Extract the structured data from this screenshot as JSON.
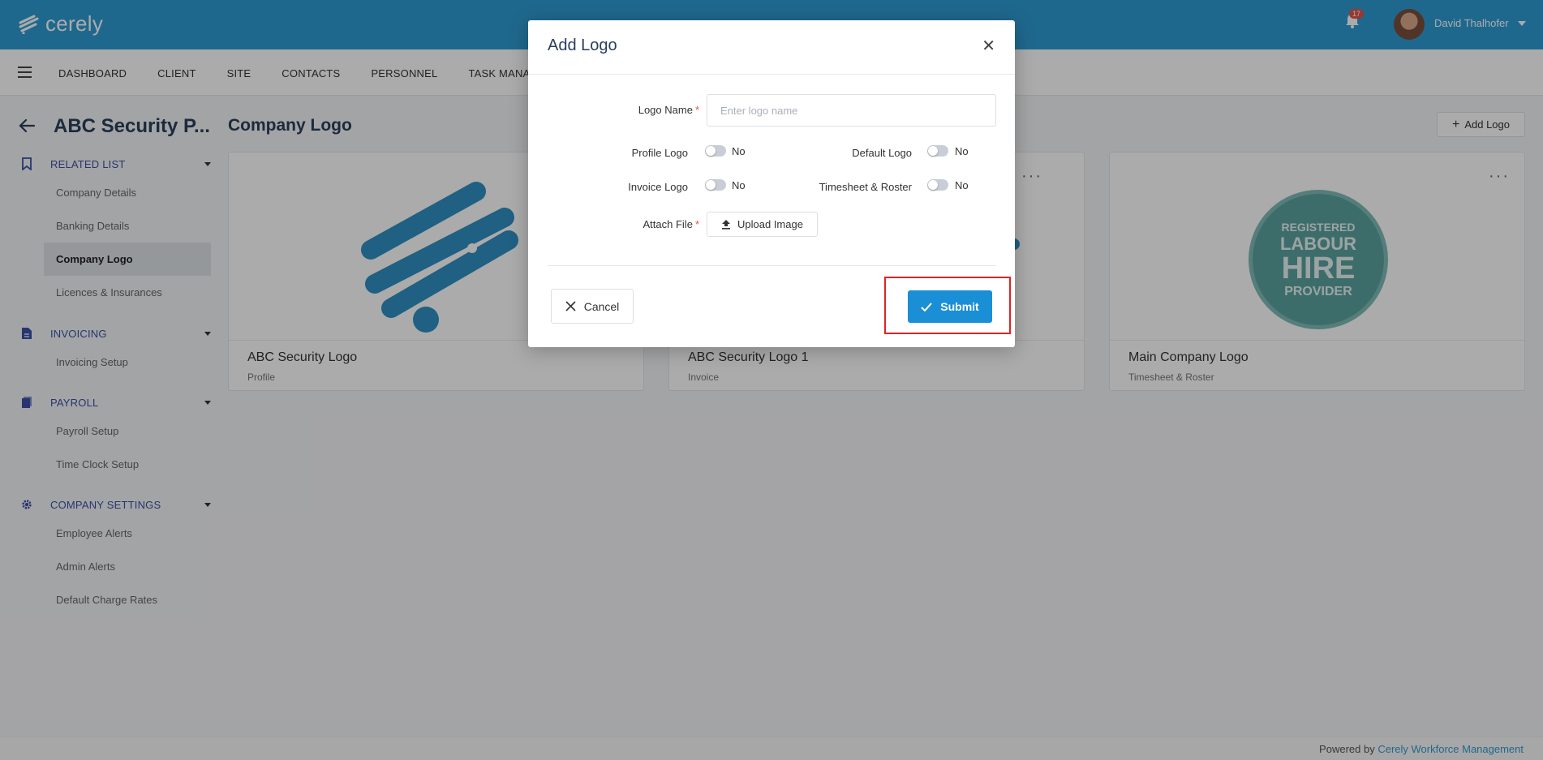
{
  "app": {
    "brand": "cerely",
    "notification_count": "17",
    "user_name": "David Thalhofer"
  },
  "nav": {
    "items": [
      "DASHBOARD",
      "CLIENT",
      "SITE",
      "CONTACTS",
      "PERSONNEL",
      "TASK MANAGER"
    ]
  },
  "sidebar": {
    "company_title": "ABC Security P...",
    "sections": [
      {
        "label": "RELATED LIST",
        "icon": "bookmark-icon",
        "items": [
          "Company Details",
          "Banking Details",
          "Company Logo",
          "Licences & Insurances"
        ]
      },
      {
        "label": "INVOICING",
        "icon": "document-icon",
        "items": [
          "Invoicing Setup"
        ]
      },
      {
        "label": "PAYROLL",
        "icon": "file-icon",
        "items": [
          "Payroll Setup",
          "Time Clock Setup"
        ]
      },
      {
        "label": "COMPANY SETTINGS",
        "icon": "gear-icon",
        "items": [
          "Employee Alerts",
          "Admin Alerts",
          "Default Charge Rates"
        ]
      }
    ],
    "active_item": "Company Logo"
  },
  "main": {
    "title": "Company Logo",
    "add_logo_label": "Add Logo",
    "cards": [
      {
        "name": "ABC Security Logo",
        "type": "Profile"
      },
      {
        "name": "ABC Security Logo 1",
        "type": "Invoice"
      },
      {
        "name": "Main Company Logo",
        "type": "Timesheet & Roster",
        "badge_lines": [
          "REGISTERED",
          "LABOUR",
          "HIRE",
          "PROVIDER"
        ]
      }
    ]
  },
  "modal": {
    "title": "Add Logo",
    "logo_name_label": "Logo Name",
    "logo_name_placeholder": "Enter logo name",
    "logo_name_value": "",
    "profile_logo_label": "Profile Logo",
    "profile_logo_value": "No",
    "default_logo_label": "Default Logo",
    "default_logo_value": "No",
    "invoice_logo_label": "Invoice Logo",
    "invoice_logo_value": "No",
    "timesheet_roster_label": "Timesheet & Roster",
    "timesheet_roster_value": "No",
    "attach_file_label": "Attach File",
    "upload_label": "Upload Image",
    "cancel_label": "Cancel",
    "submit_label": "Submit",
    "required_mark": "*"
  },
  "footer": {
    "prefix": "Powered by",
    "link": "Cerely Workforce Management"
  },
  "colors": {
    "brand": "#2f9cd3",
    "submit": "#1a8fd6",
    "section_label": "#3b4fa8",
    "highlight": "#e02424",
    "badge_teal": "#5ba3a0"
  }
}
